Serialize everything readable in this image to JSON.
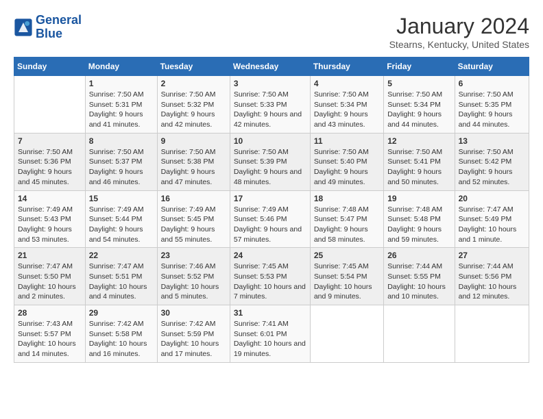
{
  "header": {
    "logo_line1": "General",
    "logo_line2": "Blue",
    "month": "January 2024",
    "location": "Stearns, Kentucky, United States"
  },
  "weekdays": [
    "Sunday",
    "Monday",
    "Tuesday",
    "Wednesday",
    "Thursday",
    "Friday",
    "Saturday"
  ],
  "weeks": [
    [
      {
        "day": "",
        "sunrise": "",
        "sunset": "",
        "daylight": ""
      },
      {
        "day": "1",
        "sunrise": "Sunrise: 7:50 AM",
        "sunset": "Sunset: 5:31 PM",
        "daylight": "Daylight: 9 hours and 41 minutes."
      },
      {
        "day": "2",
        "sunrise": "Sunrise: 7:50 AM",
        "sunset": "Sunset: 5:32 PM",
        "daylight": "Daylight: 9 hours and 42 minutes."
      },
      {
        "day": "3",
        "sunrise": "Sunrise: 7:50 AM",
        "sunset": "Sunset: 5:33 PM",
        "daylight": "Daylight: 9 hours and 42 minutes."
      },
      {
        "day": "4",
        "sunrise": "Sunrise: 7:50 AM",
        "sunset": "Sunset: 5:34 PM",
        "daylight": "Daylight: 9 hours and 43 minutes."
      },
      {
        "day": "5",
        "sunrise": "Sunrise: 7:50 AM",
        "sunset": "Sunset: 5:34 PM",
        "daylight": "Daylight: 9 hours and 44 minutes."
      },
      {
        "day": "6",
        "sunrise": "Sunrise: 7:50 AM",
        "sunset": "Sunset: 5:35 PM",
        "daylight": "Daylight: 9 hours and 44 minutes."
      }
    ],
    [
      {
        "day": "7",
        "sunrise": "Sunrise: 7:50 AM",
        "sunset": "Sunset: 5:36 PM",
        "daylight": "Daylight: 9 hours and 45 minutes."
      },
      {
        "day": "8",
        "sunrise": "Sunrise: 7:50 AM",
        "sunset": "Sunset: 5:37 PM",
        "daylight": "Daylight: 9 hours and 46 minutes."
      },
      {
        "day": "9",
        "sunrise": "Sunrise: 7:50 AM",
        "sunset": "Sunset: 5:38 PM",
        "daylight": "Daylight: 9 hours and 47 minutes."
      },
      {
        "day": "10",
        "sunrise": "Sunrise: 7:50 AM",
        "sunset": "Sunset: 5:39 PM",
        "daylight": "Daylight: 9 hours and 48 minutes."
      },
      {
        "day": "11",
        "sunrise": "Sunrise: 7:50 AM",
        "sunset": "Sunset: 5:40 PM",
        "daylight": "Daylight: 9 hours and 49 minutes."
      },
      {
        "day": "12",
        "sunrise": "Sunrise: 7:50 AM",
        "sunset": "Sunset: 5:41 PM",
        "daylight": "Daylight: 9 hours and 50 minutes."
      },
      {
        "day": "13",
        "sunrise": "Sunrise: 7:50 AM",
        "sunset": "Sunset: 5:42 PM",
        "daylight": "Daylight: 9 hours and 52 minutes."
      }
    ],
    [
      {
        "day": "14",
        "sunrise": "Sunrise: 7:49 AM",
        "sunset": "Sunset: 5:43 PM",
        "daylight": "Daylight: 9 hours and 53 minutes."
      },
      {
        "day": "15",
        "sunrise": "Sunrise: 7:49 AM",
        "sunset": "Sunset: 5:44 PM",
        "daylight": "Daylight: 9 hours and 54 minutes."
      },
      {
        "day": "16",
        "sunrise": "Sunrise: 7:49 AM",
        "sunset": "Sunset: 5:45 PM",
        "daylight": "Daylight: 9 hours and 55 minutes."
      },
      {
        "day": "17",
        "sunrise": "Sunrise: 7:49 AM",
        "sunset": "Sunset: 5:46 PM",
        "daylight": "Daylight: 9 hours and 57 minutes."
      },
      {
        "day": "18",
        "sunrise": "Sunrise: 7:48 AM",
        "sunset": "Sunset: 5:47 PM",
        "daylight": "Daylight: 9 hours and 58 minutes."
      },
      {
        "day": "19",
        "sunrise": "Sunrise: 7:48 AM",
        "sunset": "Sunset: 5:48 PM",
        "daylight": "Daylight: 9 hours and 59 minutes."
      },
      {
        "day": "20",
        "sunrise": "Sunrise: 7:47 AM",
        "sunset": "Sunset: 5:49 PM",
        "daylight": "Daylight: 10 hours and 1 minute."
      }
    ],
    [
      {
        "day": "21",
        "sunrise": "Sunrise: 7:47 AM",
        "sunset": "Sunset: 5:50 PM",
        "daylight": "Daylight: 10 hours and 2 minutes."
      },
      {
        "day": "22",
        "sunrise": "Sunrise: 7:47 AM",
        "sunset": "Sunset: 5:51 PM",
        "daylight": "Daylight: 10 hours and 4 minutes."
      },
      {
        "day": "23",
        "sunrise": "Sunrise: 7:46 AM",
        "sunset": "Sunset: 5:52 PM",
        "daylight": "Daylight: 10 hours and 5 minutes."
      },
      {
        "day": "24",
        "sunrise": "Sunrise: 7:45 AM",
        "sunset": "Sunset: 5:53 PM",
        "daylight": "Daylight: 10 hours and 7 minutes."
      },
      {
        "day": "25",
        "sunrise": "Sunrise: 7:45 AM",
        "sunset": "Sunset: 5:54 PM",
        "daylight": "Daylight: 10 hours and 9 minutes."
      },
      {
        "day": "26",
        "sunrise": "Sunrise: 7:44 AM",
        "sunset": "Sunset: 5:55 PM",
        "daylight": "Daylight: 10 hours and 10 minutes."
      },
      {
        "day": "27",
        "sunrise": "Sunrise: 7:44 AM",
        "sunset": "Sunset: 5:56 PM",
        "daylight": "Daylight: 10 hours and 12 minutes."
      }
    ],
    [
      {
        "day": "28",
        "sunrise": "Sunrise: 7:43 AM",
        "sunset": "Sunset: 5:57 PM",
        "daylight": "Daylight: 10 hours and 14 minutes."
      },
      {
        "day": "29",
        "sunrise": "Sunrise: 7:42 AM",
        "sunset": "Sunset: 5:58 PM",
        "daylight": "Daylight: 10 hours and 16 minutes."
      },
      {
        "day": "30",
        "sunrise": "Sunrise: 7:42 AM",
        "sunset": "Sunset: 5:59 PM",
        "daylight": "Daylight: 10 hours and 17 minutes."
      },
      {
        "day": "31",
        "sunrise": "Sunrise: 7:41 AM",
        "sunset": "Sunset: 6:01 PM",
        "daylight": "Daylight: 10 hours and 19 minutes."
      },
      {
        "day": "",
        "sunrise": "",
        "sunset": "",
        "daylight": ""
      },
      {
        "day": "",
        "sunrise": "",
        "sunset": "",
        "daylight": ""
      },
      {
        "day": "",
        "sunrise": "",
        "sunset": "",
        "daylight": ""
      }
    ]
  ]
}
